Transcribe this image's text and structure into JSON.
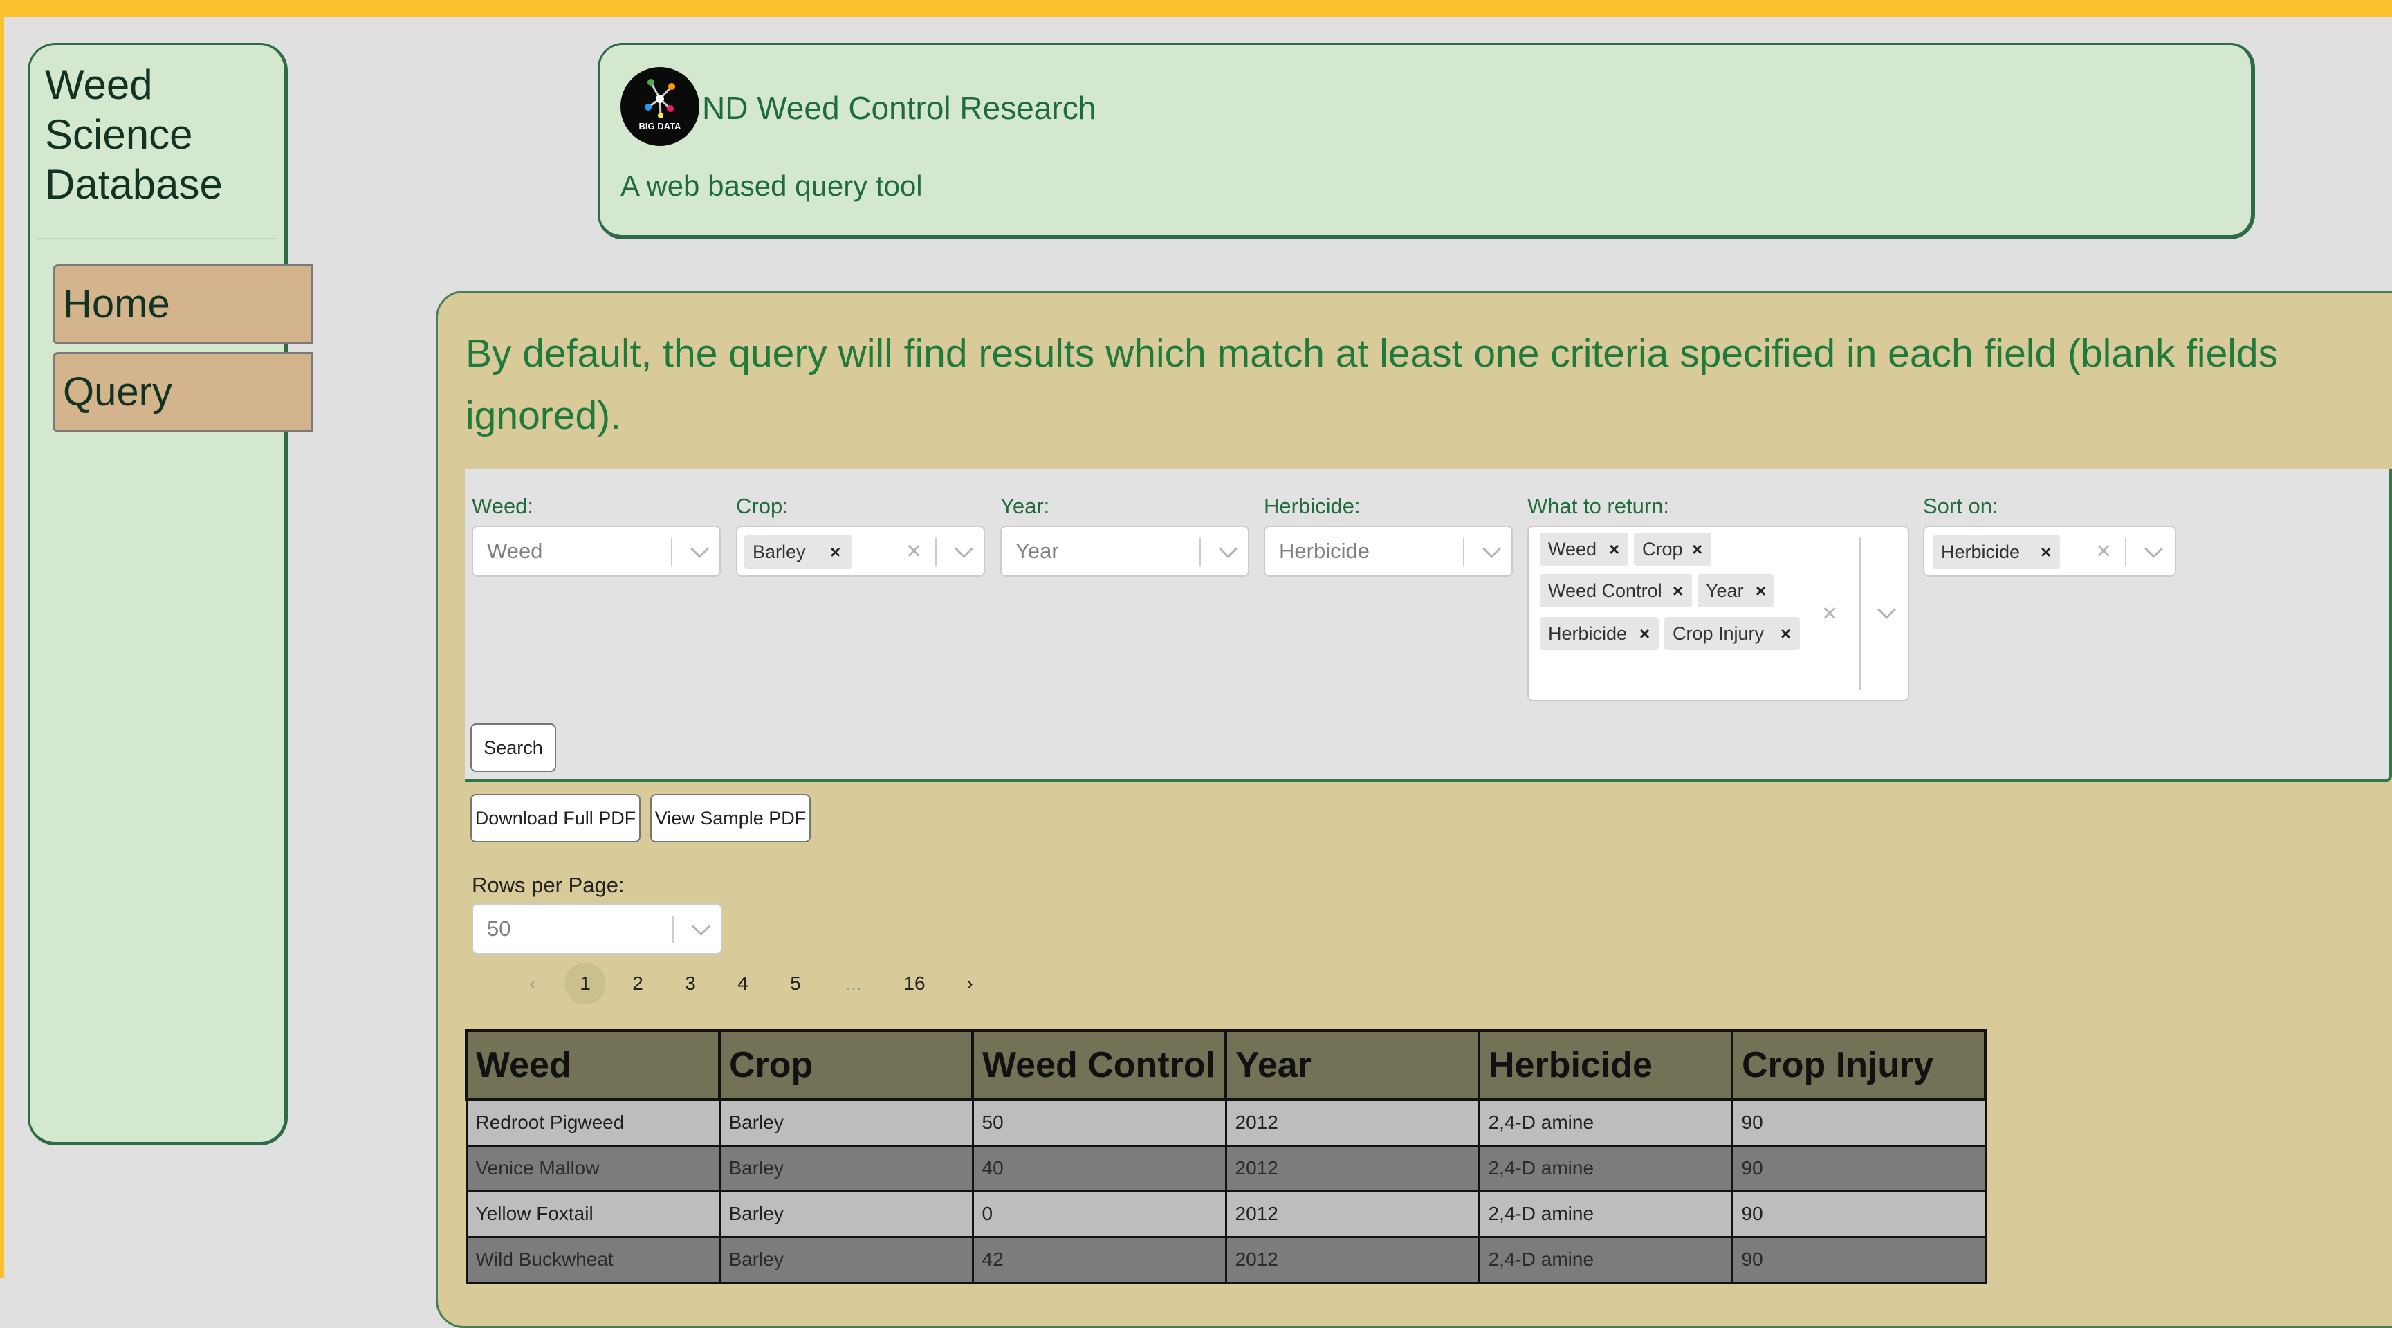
{
  "sidebar": {
    "title_lines": [
      "Weed",
      "Science",
      "Database"
    ],
    "nav": [
      {
        "label": "Home"
      },
      {
        "label": "Query"
      }
    ]
  },
  "header": {
    "logo_text": "BIG DATA",
    "title": "ND Weed Control Research",
    "subtitle": "A web based query tool"
  },
  "info_text": "By default, the query will find results which match at least one criteria specified in each field (blank fields ignored).",
  "filters": {
    "weed": {
      "label": "Weed:",
      "placeholder": "Weed"
    },
    "crop": {
      "label": "Crop:",
      "selected": [
        "Barley"
      ]
    },
    "year": {
      "label": "Year:",
      "placeholder": "Year"
    },
    "herbicide": {
      "label": "Herbicide:",
      "placeholder": "Herbicide"
    },
    "what_to_return": {
      "label": "What to return:",
      "selected": [
        "Weed",
        "Crop",
        "Weed Control",
        "Year",
        "Herbicide",
        "Crop Injury"
      ]
    },
    "sort_on": {
      "label": "Sort on:",
      "selected": [
        "Herbicide"
      ]
    },
    "chip_remove": "×",
    "clear": "×"
  },
  "buttons": {
    "search": "Search",
    "download_full_pdf": "Download Full PDF",
    "view_sample_pdf": "View Sample PDF"
  },
  "rows_per_page": {
    "label": "Rows per Page:",
    "value": "50"
  },
  "pagination": {
    "prev": "‹",
    "pages": [
      "1",
      "2",
      "3",
      "4",
      "5"
    ],
    "ellipsis": "...",
    "last": "16",
    "next": "›",
    "current": "1"
  },
  "table": {
    "headers": [
      "Weed",
      "Crop",
      "Weed Control",
      "Year",
      "Herbicide",
      "Crop Injury"
    ],
    "rows": [
      [
        "Redroot Pigweed",
        "Barley",
        "50",
        "2012",
        "2,4-D amine",
        "90"
      ],
      [
        "Venice Mallow",
        "Barley",
        "40",
        "2012",
        "2,4-D amine",
        "90"
      ],
      [
        "Yellow Foxtail",
        "Barley",
        "0",
        "2012",
        "2,4-D amine",
        "90"
      ],
      [
        "Wild Buckwheat",
        "Barley",
        "42",
        "2012",
        "2,4-D amine",
        "90"
      ]
    ]
  },
  "colors": {
    "top_bar": "#fbc02d",
    "panel_green": "#d4e8d0",
    "panel_tan": "#d8cb99",
    "accent_text": "#1f7a3c",
    "nav_button": "#d4b48c"
  }
}
